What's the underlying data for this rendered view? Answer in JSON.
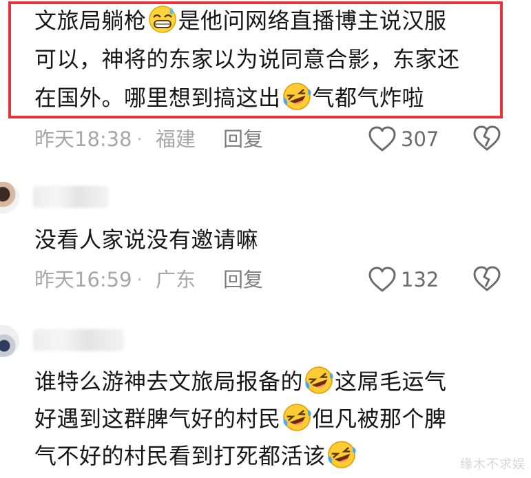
{
  "comments": [
    {
      "lines": [
        [
          "文旅局躺枪",
          "😅",
          "是他问网络直播博主说汉服"
        ],
        [
          "可以，神将的东家以为说同意合影，东家还"
        ],
        [
          "在国外。哪里想到搞这出",
          "🤣",
          "气都气炸啦"
        ]
      ],
      "time": "昨天18:38",
      "dot": "·",
      "location": "福建",
      "reply": "回复",
      "likes": "307"
    },
    {
      "lines": [
        [
          "没看人家说没有邀请嘛"
        ]
      ],
      "time": "昨天16:59",
      "dot": "·",
      "location": "广东",
      "reply": "回复",
      "likes": "132"
    },
    {
      "lines": [
        [
          "谁特么游神去文旅局报备的",
          "🤣",
          "这屌毛运气"
        ],
        [
          "好遇到这群脾气好的村民",
          "🤣",
          "但凡被那个脾"
        ],
        [
          "气不好的村民看到打死都活该",
          "🤣"
        ]
      ]
    }
  ],
  "watermark": "缘木不求娱",
  "colors": {
    "highlight": "#e8333b",
    "meta": "#a7a7a7",
    "text": "#161616"
  },
  "icons": {
    "like": "heart-outline-icon",
    "dislike": "broken-heart-icon"
  }
}
